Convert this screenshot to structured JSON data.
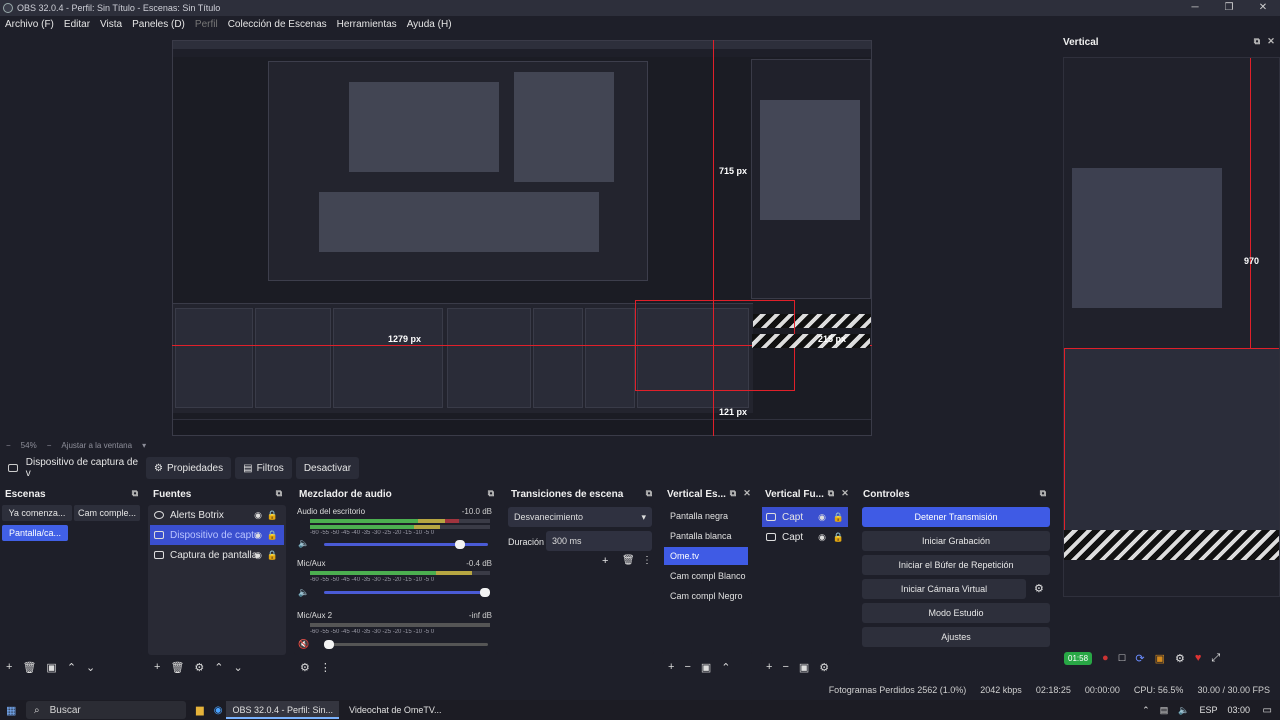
{
  "window": {
    "title": "OBS 32.0.4 - Perfil: Sin Título - Escenas: Sin Título",
    "controls": [
      "─",
      "❐",
      "✕"
    ]
  },
  "menu": [
    "Archivo (F)",
    "Editar",
    "Vista",
    "Paneles (D)",
    "Perfil",
    "Colección de Escenas",
    "Herramientas",
    "Ayuda (H)"
  ],
  "preview": {
    "measures": {
      "m715": "715 px",
      "m215": "215 px",
      "m121": "121 px",
      "m1279": "1279 px"
    },
    "zoom": "54%",
    "fit": "Ajustar a la ventana",
    "bound_window": "Videochat de OmeTV..."
  },
  "source_toolbar": {
    "source_name": "Dispositivo de captura de v",
    "properties": "Propiedades",
    "filters": "Filtros",
    "deactivate": "Desactivar"
  },
  "docks": {
    "scenes": {
      "title": "Escenas",
      "items": [
        "Ya comenza...",
        "Cam comple...",
        "Pantalla/ca..."
      ]
    },
    "sources": {
      "title": "Fuentes",
      "items": [
        "Alerts Botrix",
        "Dispositivo de captu",
        "Captura de pantalla"
      ]
    },
    "mixer": {
      "title": "Mezclador de audio",
      "channels": [
        {
          "name": "Audio del escritorio",
          "db": "-10.0 dB",
          "level": 0.75,
          "vol": 0.85
        },
        {
          "name": "Mic/Aux",
          "db": "-0.4 dB",
          "level": 0.95,
          "vol": 1.0
        },
        {
          "name": "Mic/Aux 2",
          "db": "-inf dB",
          "level": 0.0,
          "vol": 0.0
        }
      ],
      "scale": "-60 -55 -50 -45 -40 -35 -30 -25 -20 -15 -10 -5 0"
    },
    "transitions": {
      "title": "Transiciones de escena",
      "transition": "Desvanecimiento",
      "duration_label": "Duración",
      "duration_value": "300 ms"
    },
    "vertical_scenes": {
      "title": "Vertical Es...",
      "items": [
        "Pantalla negra",
        "Pantalla blanca",
        "Ome.tv",
        "Cam compl Blanco",
        "Cam compl Negro"
      ]
    },
    "vertical_sources": {
      "title": "Vertical Fu...",
      "items": [
        "Capt",
        "Capt"
      ]
    },
    "controls": {
      "title": "Controles",
      "buttons": [
        "Detener Transmisión",
        "Iniciar Grabación",
        "Iniciar el Búfer de Repetición",
        "Iniciar Cámara Virtual",
        "Modo Estudio",
        "Ajustes"
      ]
    }
  },
  "vertical": {
    "title": "Vertical",
    "measure": "970",
    "live_time": "01:58"
  },
  "status": {
    "dropped": "Fotogramas Perdidos 2562 (1.0%)",
    "bitrate": "2042 kbps",
    "stream_time": "02:18:25",
    "rec_time": "00:00:00",
    "cpu": "CPU: 56.5%",
    "fps": "30.00 / 30.00 FPS"
  },
  "taskbar": {
    "search": "Buscar",
    "items": [
      "OBS 32.0.4 - Perfil: Sin...",
      "Videochat de OmeTV..."
    ],
    "lang": "ESP",
    "clock": "03:00"
  },
  "colors": {
    "accent": "#3f5be5",
    "bg": "#1e1f29",
    "panel": "#292a35",
    "measure_red": "#e0202a"
  }
}
